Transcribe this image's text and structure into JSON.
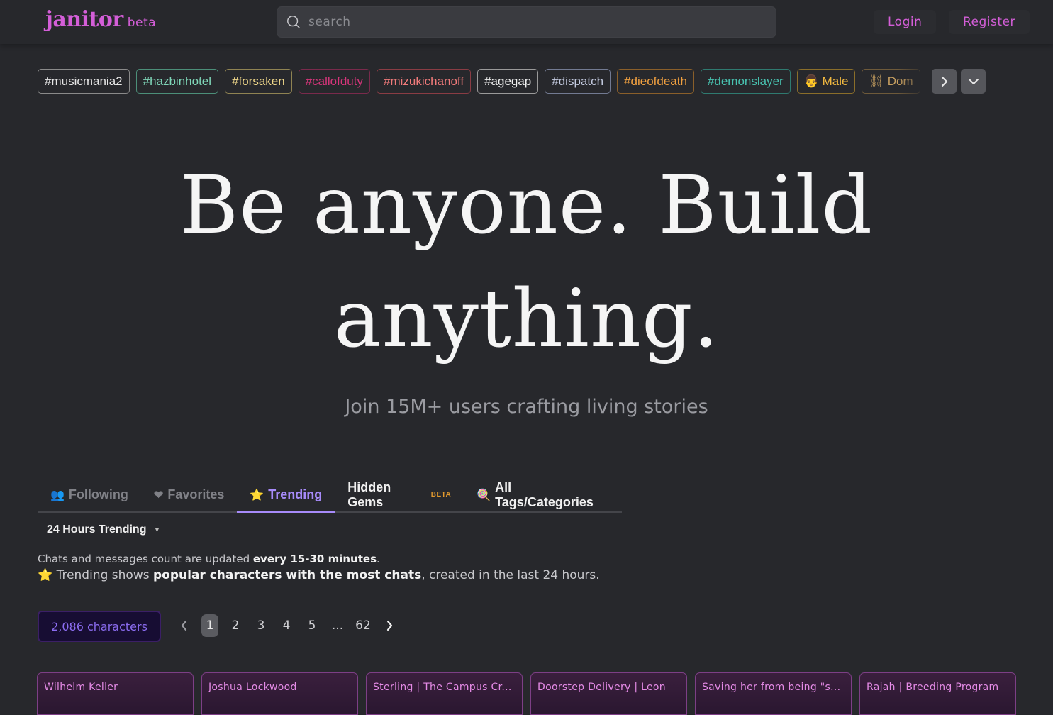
{
  "header": {
    "logo_text": "janitor",
    "logo_beta": "beta",
    "search_placeholder": "search",
    "login_label": "Login",
    "register_label": "Register"
  },
  "tags": [
    {
      "label": "#musicmania2",
      "color": "#e6e6e6",
      "border": "#8a8a8a"
    },
    {
      "label": "#hazbinhotel",
      "color": "#7fd6b8",
      "border": "#4c8f79"
    },
    {
      "label": "#forsaken",
      "color": "#f0d88a",
      "border": "#8f8352"
    },
    {
      "label": "#callofduty",
      "color": "#d6357a",
      "border": "#7a2a4c"
    },
    {
      "label": "#mizukichanoff",
      "color": "#f07a7a",
      "border": "#8a3c44"
    },
    {
      "label": "#agegap",
      "color": "#f0f0f0",
      "border": "#9a9a9a"
    },
    {
      "label": "#dispatch",
      "color": "#c4cbe0",
      "border": "#727a92"
    },
    {
      "label": "#dieofdeath",
      "color": "#f0a040",
      "border": "#8a5f2a"
    },
    {
      "label": "#demonslayer",
      "color": "#48c2b0",
      "border": "#2f7a70"
    },
    {
      "label": "👨 Male",
      "color": "#f0b840",
      "border": "#8a6e2a"
    },
    {
      "label": "⛓ Dom",
      "color": "#c8a060",
      "border": "#6e5a3a"
    }
  ],
  "hero": {
    "line1": "Be anyone. Build",
    "line2": "anything.",
    "subtitle": "Join 15M+ users crafting living stories"
  },
  "tabs": [
    {
      "icon": "👥",
      "label": "Following",
      "style": "muted"
    },
    {
      "icon": "❤",
      "label": "Favorites",
      "style": "muted"
    },
    {
      "icon": "⭐",
      "label": "Trending",
      "style": "active"
    },
    {
      "icon": "",
      "label": "Hidden Gems",
      "badge": "BETA",
      "style": "white"
    },
    {
      "icon": "🍭",
      "label": "All Tags/Categories",
      "style": "white"
    }
  ],
  "trending": {
    "select_label": "24 Hours Trending",
    "info1_pre": "Chats and messages count are updated ",
    "info1_bold": "every 15-30 minutes",
    "info1_post": ".",
    "info2_icon": "⭐",
    "info2_pre": " Trending shows ",
    "info2_bold": "popular characters with the most chats",
    "info2_post": ", created in the last 24 hours."
  },
  "pagination": {
    "count_label": "2,086 characters",
    "pages": [
      "1",
      "2",
      "3",
      "4",
      "5",
      "...",
      "62"
    ],
    "active": "1"
  },
  "cards": [
    "Wilhelm Keller",
    "Joshua Lockwood",
    "Sterling | The Campus Cr...",
    "Doorstep Delivery | Leon",
    "Saving her from being \"s...",
    "Rajah | Breeding Program"
  ],
  "colors": {
    "background": "#27282c",
    "brand": "#d45ed8",
    "accent": "#a78bfa"
  }
}
